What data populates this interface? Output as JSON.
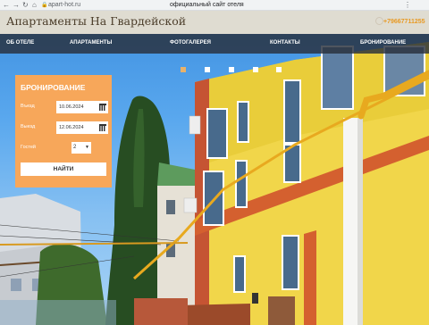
{
  "browser": {
    "url": "apart-hot.ru",
    "page_title": "официальный сайт отеля"
  },
  "header": {
    "logo": "Апартаменты На Гвардейской",
    "phone": "+79667711255"
  },
  "menu": [
    {
      "label": "Об отеле"
    },
    {
      "label": "Апартаменты"
    },
    {
      "label": "Фотогалерея"
    },
    {
      "label": "Контакты"
    },
    {
      "label": "Бронирование"
    }
  ],
  "slider": {
    "slide_count": 5,
    "active_index": 0
  },
  "booking": {
    "title": "Бронирование",
    "checkin_label": "Въезд",
    "checkin_value": "10.06.2024",
    "checkout_label": "Выезд",
    "checkout_value": "12.06.2024",
    "guests_label": "Гостей",
    "guests_value": "2",
    "submit_label": "Найти"
  },
  "colors": {
    "accent": "#F7A75A",
    "menu_bg": "#283040",
    "phone": "#E89A24"
  }
}
